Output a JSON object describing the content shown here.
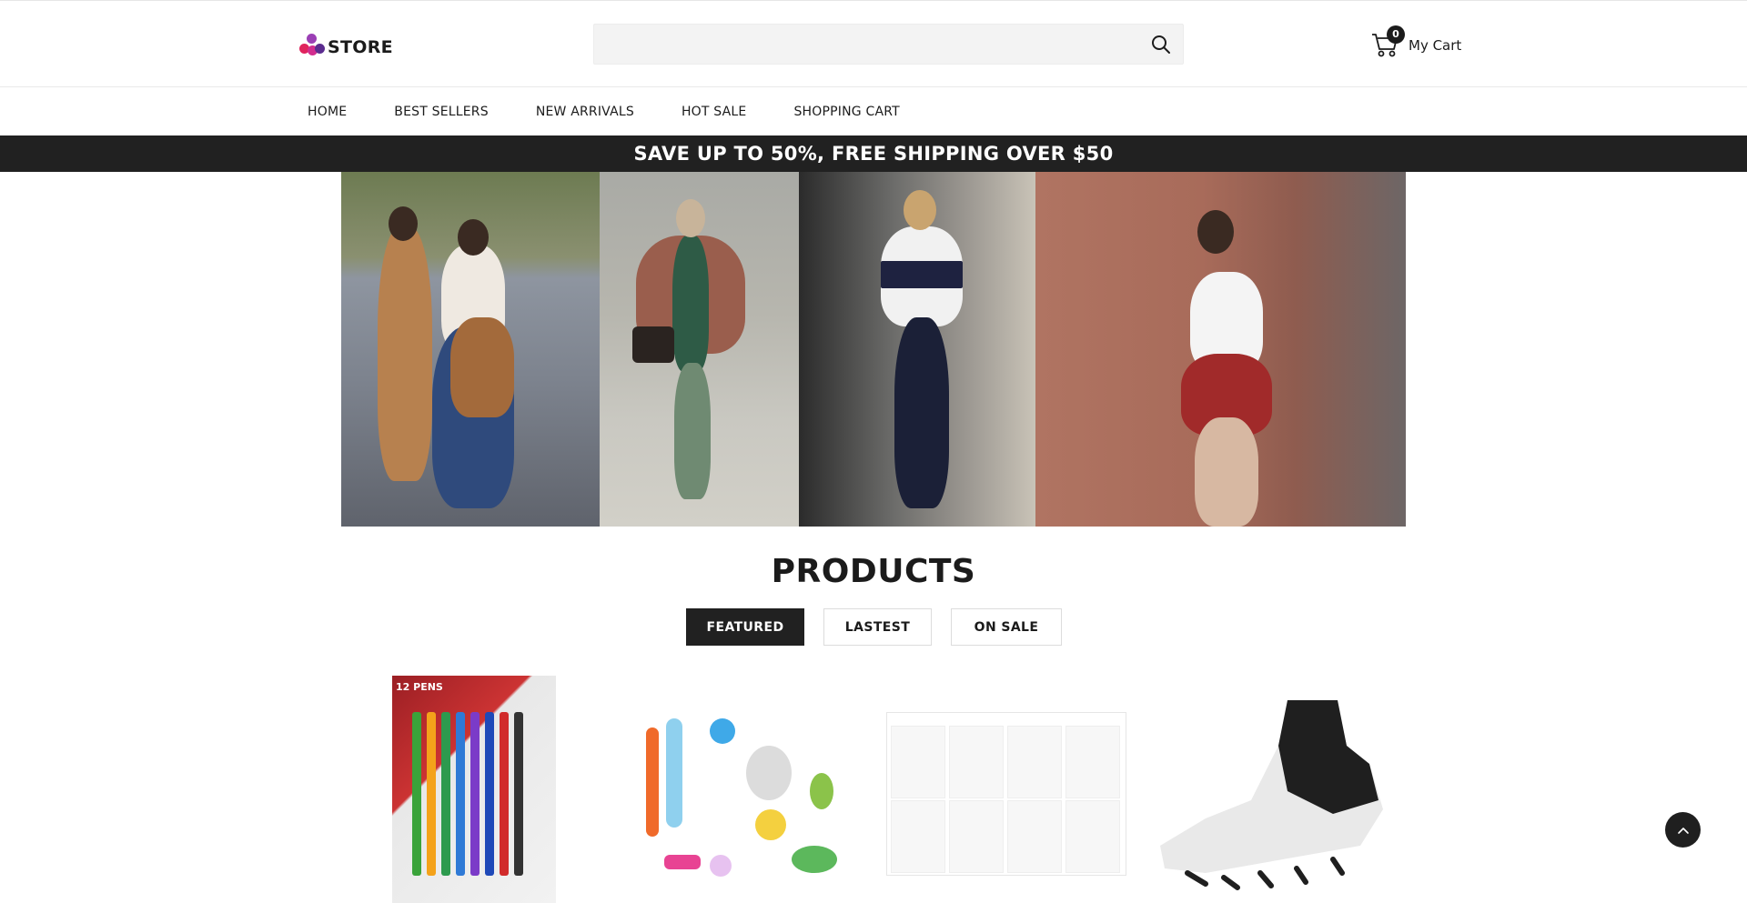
{
  "header": {
    "logo_text": "STORE",
    "logo_colors": [
      "#e0245e",
      "#8e44ad",
      "#5b2c8f"
    ],
    "search": {
      "placeholder": "",
      "value": "",
      "icon": "search-icon"
    },
    "cart": {
      "count": "0",
      "label": "My Cart",
      "icon": "cart-icon"
    }
  },
  "nav": {
    "items": [
      {
        "label": "HOME"
      },
      {
        "label": "BEST SELLERS"
      },
      {
        "label": "NEW ARRIVALS"
      },
      {
        "label": "HOT SALE"
      },
      {
        "label": "SHOPPING CART"
      }
    ]
  },
  "promo": {
    "text": "SAVE UP TO 50%, FREE SHIPPING OVER $50"
  },
  "products": {
    "title": "PRODUCTS",
    "tabs": [
      {
        "label": "FEATURED",
        "active": true
      },
      {
        "label": "LASTEST",
        "active": false
      },
      {
        "label": "ON SALE",
        "active": false
      }
    ],
    "pens_label": "12 PENS"
  },
  "colors": {
    "dark": "#212121",
    "text": "#1b1b1b",
    "search_bg": "#f3f3f3"
  },
  "back_to_top": {
    "icon": "chevron-up-icon"
  }
}
